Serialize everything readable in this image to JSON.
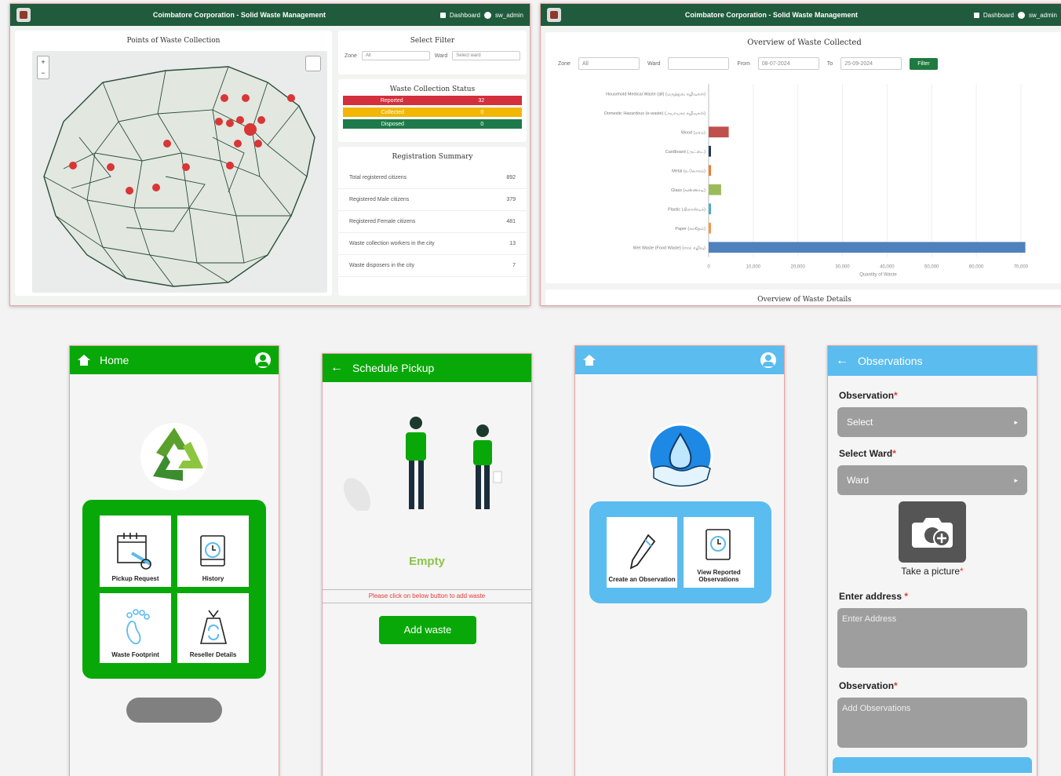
{
  "dashboard_left": {
    "header_title": "Coimbatore Corporation - Solid Waste Management",
    "nav_dashboard": "Dashboard",
    "nav_user": "sw_admin",
    "map_title": "Points of Waste Collection",
    "filter_title": "Select Filter",
    "zone_label": "Zone",
    "zone_value": "All",
    "ward_label": "Ward",
    "ward_placeholder": "Select ward",
    "status_title": "Waste Collection Status",
    "status": [
      {
        "label": "Reported",
        "count": "32",
        "color": "#d32f3c"
      },
      {
        "label": "Collected",
        "count": "0",
        "color": "#f2b705"
      },
      {
        "label": "Disposed",
        "count": "0",
        "color": "#1e7a4a"
      }
    ],
    "summary_title": "Registration Summary",
    "summary": [
      {
        "label": "Total registered citizens",
        "value": "892"
      },
      {
        "label": "Registered Male citizens",
        "value": "379"
      },
      {
        "label": "Registered Female citizens",
        "value": "481"
      },
      {
        "label": "Waste collection workers in the city",
        "value": "13"
      },
      {
        "label": "Waste disposers in the city",
        "value": "7"
      }
    ],
    "map_zoom_in": "+",
    "map_zoom_out": "−"
  },
  "dashboard_right": {
    "header_title": "Coimbatore Corporation - Solid Waste Management",
    "nav_dashboard": "Dashboard",
    "nav_user": "sw_admin",
    "chart_title": "Overview of Waste Collected",
    "zone_label": "Zone",
    "zone_value": "All",
    "ward_label": "Ward",
    "from_label": "From",
    "from_value": "08-07-2024",
    "to_label": "To",
    "to_value": "25-09-2024",
    "filter_button": "Filter",
    "details_title": "Overview of Waste Details"
  },
  "chart_data": {
    "type": "bar",
    "orientation": "horizontal",
    "title": "Overview of Waste Collected",
    "xlabel": "Quantity of Waste",
    "categories": [
      "Household Medical Waste (all) (மருத்துவ கழிவுகள்)",
      "Domestic Hazardous (e-waste) (அபாயகர கழிவுகள்)",
      "Wood (மரம்)",
      "Cardboard (அட்டை)",
      "Metal (உலோகம்)",
      "Glass (கண்ணாடி)",
      "Plastic (பிளாஸ்டிக்)",
      "Paper (காகிதம்)",
      "Wet Waste (Food Waste) (ஈரக் கழிவு)"
    ],
    "values": [
      0,
      0,
      4500,
      300,
      200,
      2800,
      150,
      100,
      71000
    ],
    "colors": [
      "#888888",
      "#888888",
      "#c0504d",
      "#1f3864",
      "#ed7d31",
      "#9bbb59",
      "#4bacc6",
      "#f79646",
      "#4f81bd"
    ],
    "xlim": [
      0,
      76000
    ],
    "xticks": [
      "0",
      "10,000",
      "20,000",
      "30,000",
      "40,000",
      "50,000",
      "60,000",
      "70,000"
    ]
  },
  "phone_home": {
    "title": "Home",
    "tiles": [
      "Pickup Request",
      "History",
      "Waste Footprint",
      "Reseller Details"
    ],
    "panel_color": "#08a808"
  },
  "phone_pickup": {
    "title": "Schedule Pickup",
    "empty_text": "Empty",
    "hint": "Please click on below button to add waste",
    "add_button": "Add waste"
  },
  "phone_observe": {
    "tiles": [
      "Create an Observation",
      "View Reported Observations"
    ]
  },
  "phone_observations": {
    "title": "Observations",
    "observation_label": "Observation",
    "select_placeholder": "Select",
    "ward_label": "Select Ward",
    "ward_placeholder": "Ward",
    "camera_label": "Take a picture",
    "address_label": "Enter address",
    "address_placeholder": "Enter Address",
    "observation2_label": "Observation",
    "observation_placeholder": "Add Observations",
    "required_mark": "*"
  }
}
